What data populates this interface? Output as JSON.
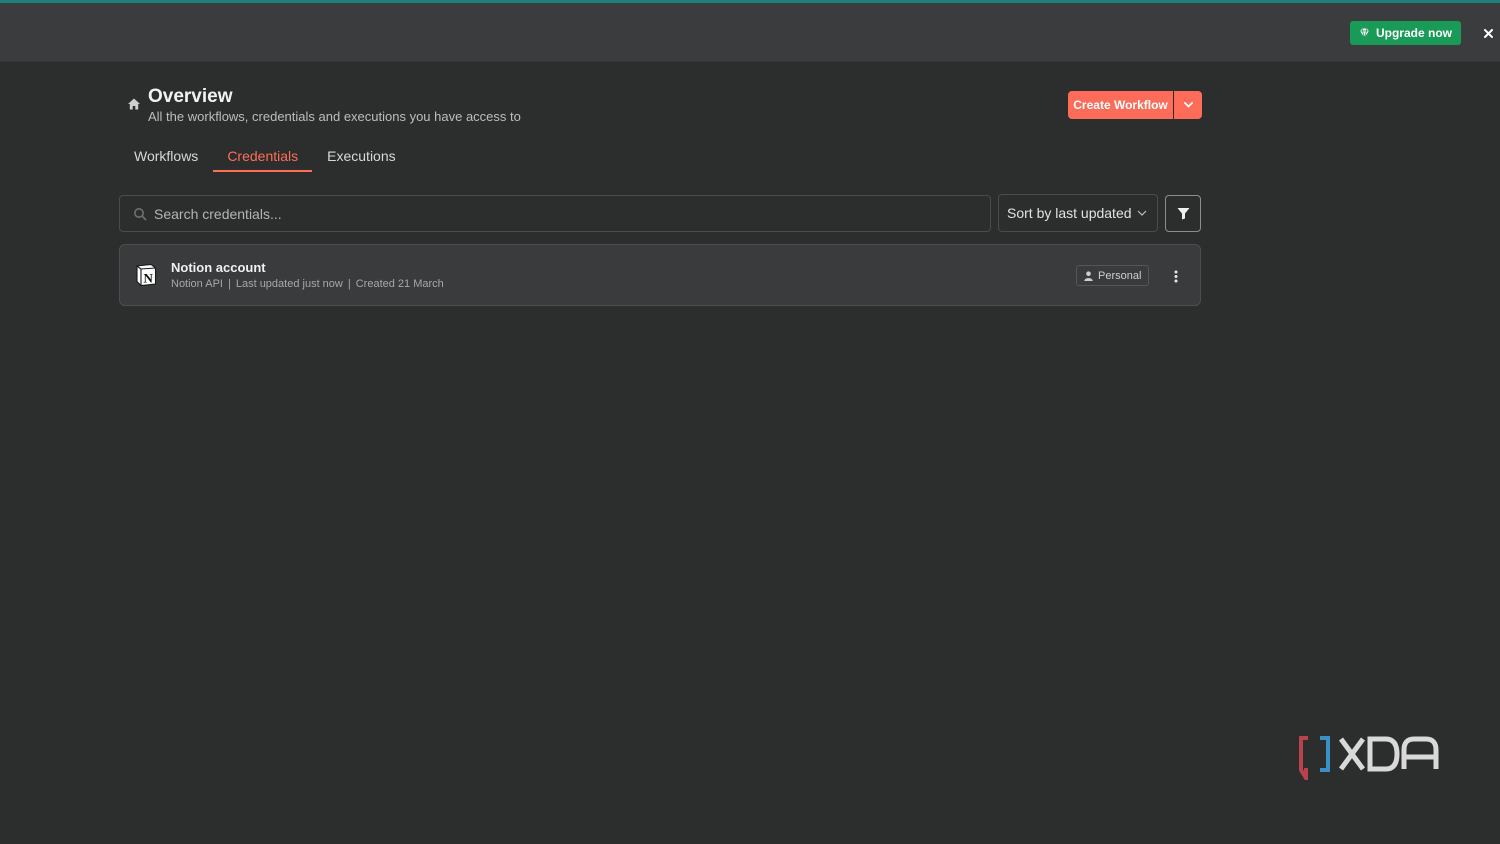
{
  "banner": {
    "upgrade_label": "Upgrade now",
    "upgrade_icon": "gem-icon",
    "close_icon": "close-icon"
  },
  "header": {
    "icon": "home-icon",
    "title": "Overview",
    "subtitle": "All the workflows, credentials and executions you have access to"
  },
  "actions": {
    "create_label": "Create Workflow",
    "caret_icon": "chevron-down-icon"
  },
  "tabs": [
    {
      "label": "Workflows",
      "active": false
    },
    {
      "label": "Credentials",
      "active": true
    },
    {
      "label": "Executions",
      "active": false
    }
  ],
  "search": {
    "placeholder": "Search credentials...",
    "value": ""
  },
  "sort": {
    "selected": "Sort by last updated"
  },
  "credentials": [
    {
      "name": "Notion account",
      "type": "Notion API",
      "updated": "Last updated just now",
      "created": "Created 21 March",
      "badge": "Personal",
      "icon": "notion-icon"
    }
  ],
  "watermark": "XDA",
  "colors": {
    "accent": "#ff6d5a",
    "upgrade": "#1a9a57",
    "background": "#2c2d2d",
    "card": "#3a3b3c"
  }
}
